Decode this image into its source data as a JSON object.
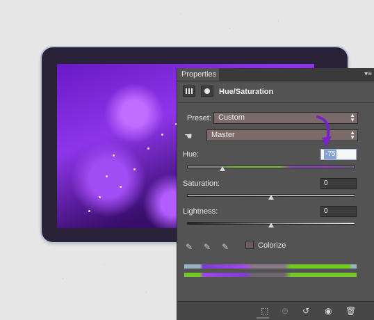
{
  "panel": {
    "tab_label": "Properties",
    "menu_glyph": "▾≡",
    "title": "Hue/Saturation",
    "icons": [
      "hue-saturation-icon",
      "layer-mask-icon"
    ]
  },
  "preset": {
    "label": "Preset:",
    "value": "Custom"
  },
  "channel": {
    "value": "Master",
    "icon": "targeted-adjustment-hand-icon"
  },
  "hue": {
    "label": "Hue:",
    "value": "-75",
    "slider_fraction": 0.21
  },
  "saturation": {
    "label": "Saturation:",
    "value": "0",
    "slider_fraction": 0.5
  },
  "lightness": {
    "label": "Lightness:",
    "value": "0",
    "slider_fraction": 0.5
  },
  "eyedroppers": [
    "eyedropper-icon",
    "eyedropper-plus-icon",
    "eyedropper-minus-icon"
  ],
  "colorize": {
    "label": "Colorize",
    "checked": false
  },
  "footer_icons": [
    "clip-to-layer-icon",
    "view-previous-state-icon",
    "reset-icon",
    "visibility-eye-icon",
    "trash-icon"
  ],
  "colors": {
    "panel_bg": "#535353",
    "accent_arrow": "#7a22c9",
    "active_field": "#87a2cf"
  }
}
